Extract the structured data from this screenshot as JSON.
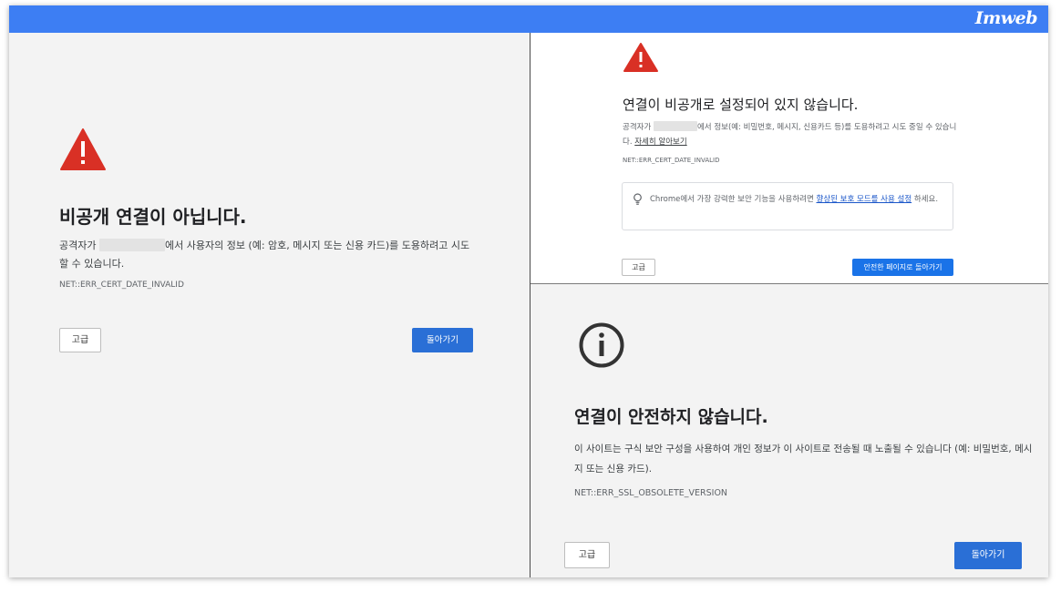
{
  "banner": {
    "logo_text": "Imweb",
    "color": "#3d7ef3"
  },
  "left_panel": {
    "icon": "warning-triangle-icon",
    "title": "비공개 연결이 아닙니다.",
    "desc_prefix": "공격자가",
    "desc_suffix": "에서 사용자의 정보 (예: 암호, 메시지 또는 신용 카드)를 도용하려고 시도할 수 있습니다.",
    "error_code": "NET::ERR_CERT_DATE_INVALID",
    "advanced_label": "고급",
    "back_label": "돌아가기"
  },
  "top_right_panel": {
    "icon": "warning-triangle-icon",
    "title": "연결이 비공개로 설정되어 있지 않습니다.",
    "desc_prefix": "공격자가",
    "desc_middle": "에서 정보(예: 비밀번호, 메시지, 신용카드 등)를 도용하려고 시도 중일 수 있습니다.",
    "learn_more": "자세히 알아보기",
    "error_code": "NET::ERR_CERT_DATE_INVALID",
    "tip_icon": "lightbulb-icon",
    "tip_prefix": "Chrome에서 가장 강력한 보안 기능을 사용하려면",
    "tip_link": "향상된 보호 모드를 사용 설정",
    "tip_suffix": "하세요.",
    "advanced_label": "고급",
    "back_label": "안전한 페이지로 돌아가기"
  },
  "bottom_right_panel": {
    "icon": "info-circle-icon",
    "title": "연결이 안전하지 않습니다.",
    "desc": "이 사이트는 구식 보안 구성을 사용하여 개인 정보가 이 사이트로 전송될 때 노출될 수 있습니다 (예: 비밀번호, 메시지 또는 신용 카드).",
    "error_code": "NET::ERR_SSL_OBSOLETE_VERSION",
    "advanced_label": "고급",
    "back_label": "돌아가기"
  },
  "colors": {
    "warning_red": "#d93025",
    "primary_blue": "#2a6fd6",
    "link_blue": "#1a56c9"
  }
}
